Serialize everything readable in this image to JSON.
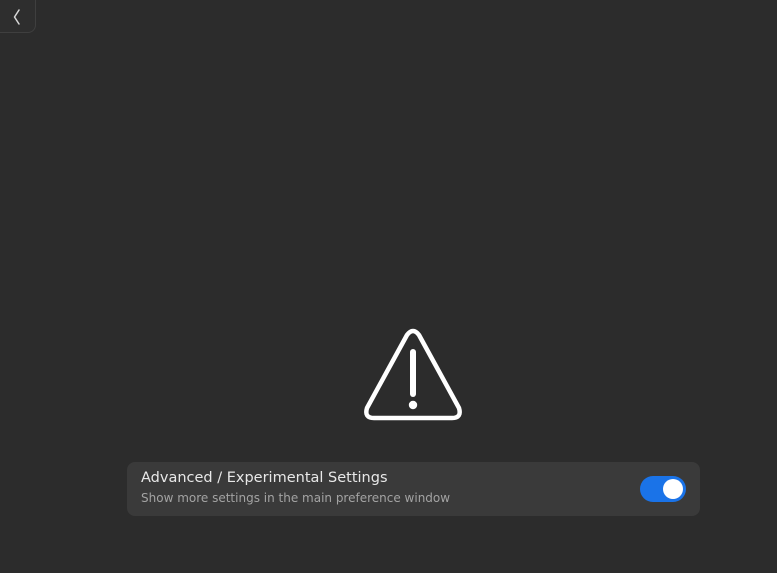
{
  "header": {
    "back_icon": "chevron-left-icon"
  },
  "status": {
    "icon": "warning-icon"
  },
  "settings_row": {
    "title": "Advanced / Experimental Settings",
    "subtitle": "Show more settings in the main preference window",
    "toggle_on": true
  },
  "colors": {
    "background": "#2c2c2c",
    "row_background": "#3a3a3a",
    "accent": "#1a73e8",
    "text_primary": "#e8e8e8",
    "text_secondary": "#a3a3a3"
  }
}
